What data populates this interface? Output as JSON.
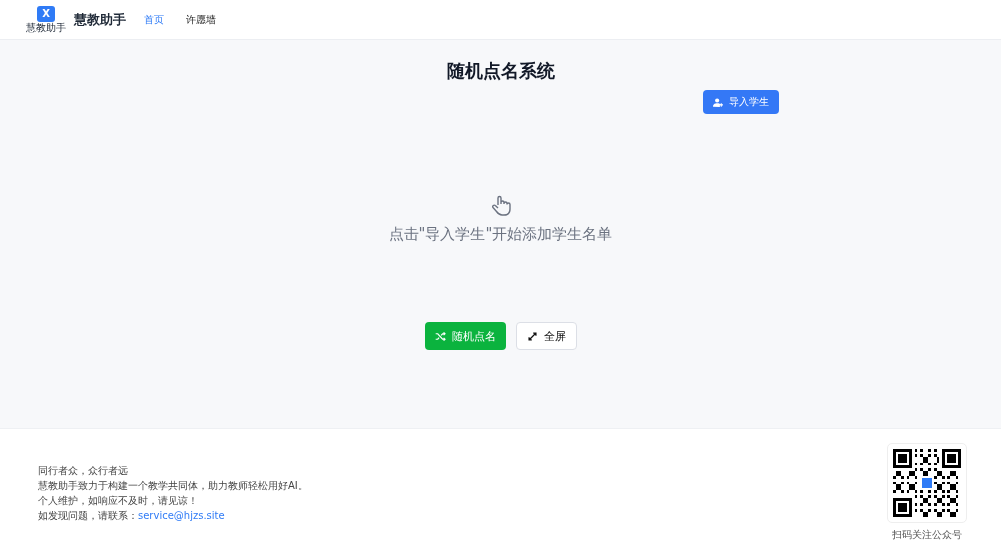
{
  "header": {
    "logo": {
      "mark": "X",
      "caption": "慧教助手"
    },
    "brand": "慧教助手",
    "nav": [
      {
        "label": "首页",
        "selected": true
      },
      {
        "label": "许愿墙",
        "selected": false
      }
    ]
  },
  "main": {
    "title": "随机点名系统",
    "import_button": "导入学生",
    "empty_text": "点击\"导入学生\"开始添加学生名单",
    "actions": [
      {
        "kind": "primary",
        "label": "随机点名"
      },
      {
        "kind": "fullscreen",
        "label": "全屏"
      }
    ]
  },
  "footer": {
    "lines": [
      "同行者众，众行者远",
      "慧教助手致力于构建一个教学共同体，助力教师轻松用好AI。",
      "个人维护，如响应不及时，请见谅！"
    ],
    "contact": {
      "label": "如发现问题，请联系：",
      "link": "service@hjzs.site"
    },
    "qr_caption": "扫码关注公众号"
  }
}
